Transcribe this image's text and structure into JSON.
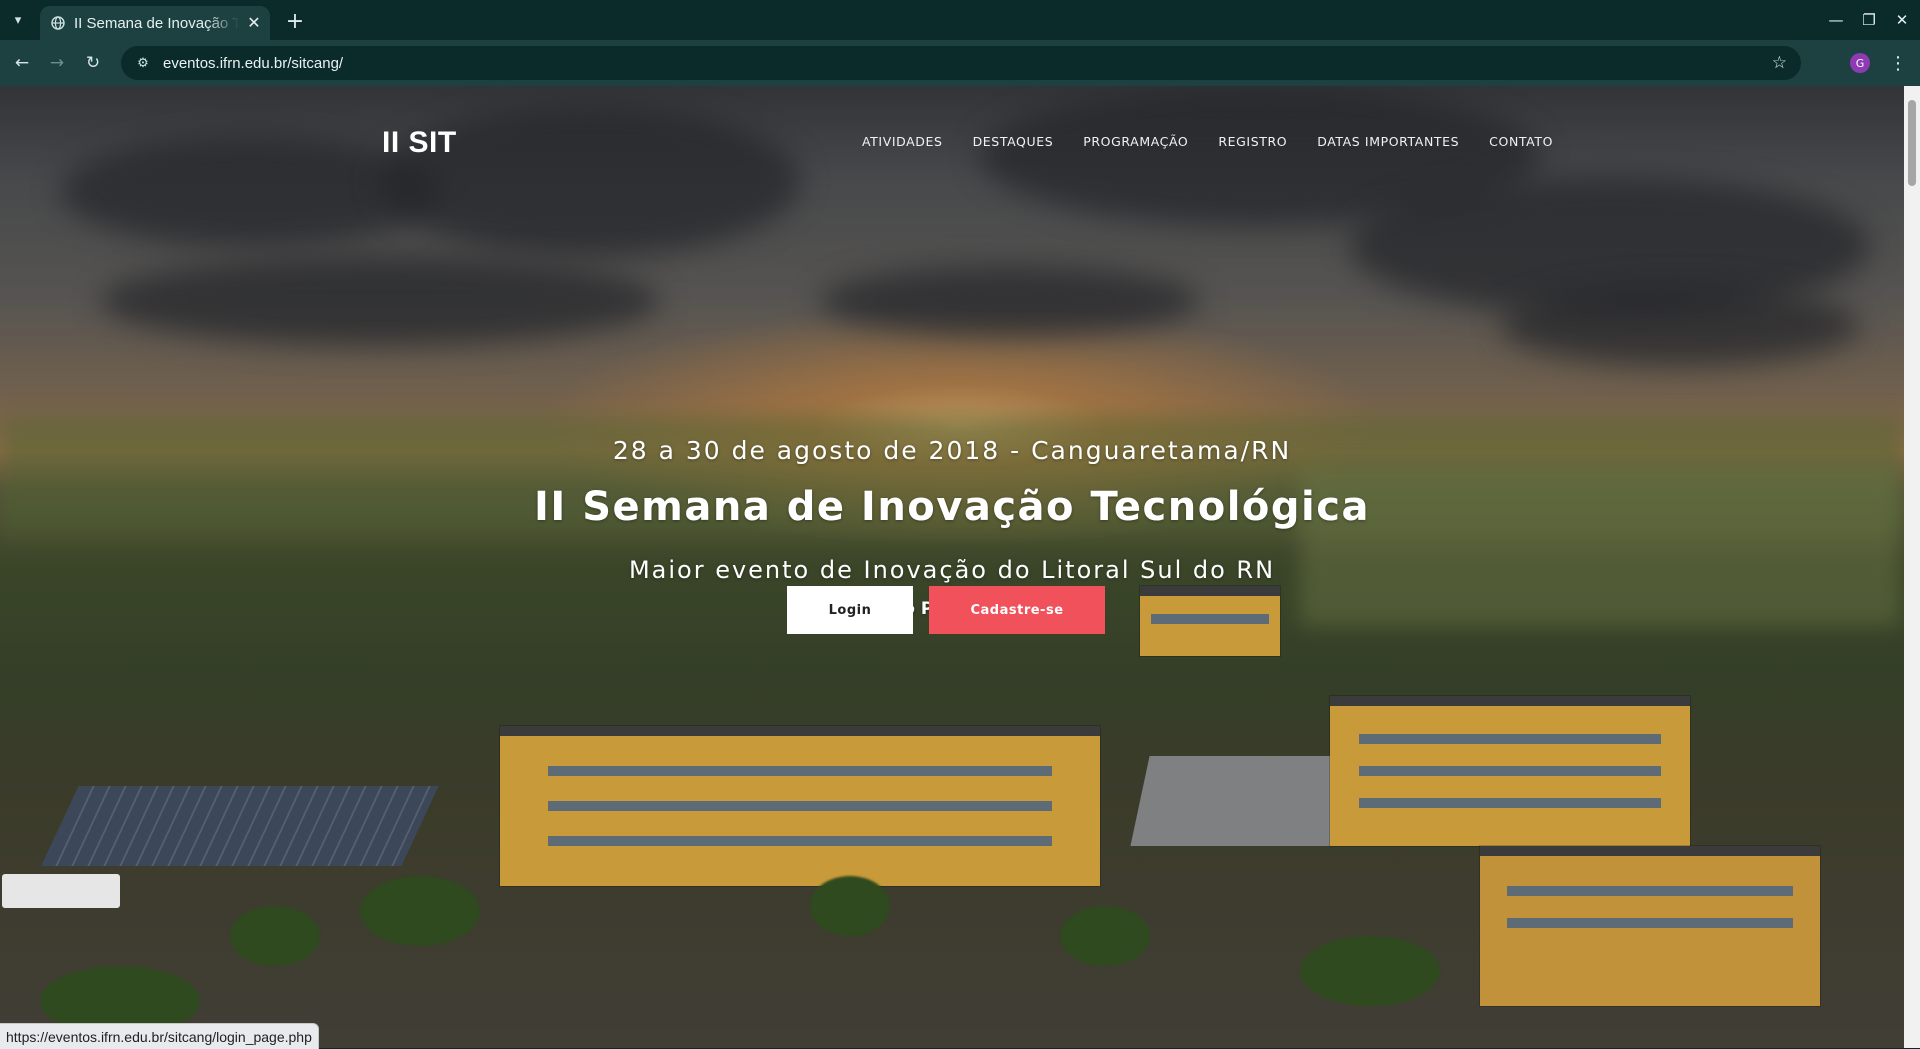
{
  "browser": {
    "tab_title": "II Semana de Inovação Tecnológica",
    "url": "eventos.ifrn.edu.br/sitcang/",
    "profile_initial": "G",
    "status_url": "https://eventos.ifrn.edu.br/sitcang/login_page.php",
    "icons": {
      "tab_search": "▾",
      "favicon": "globe-icon",
      "tab_close": "✕",
      "new_tab": "+",
      "minimize": "—",
      "restore": "❐",
      "close": "✕",
      "back": "←",
      "forward": "→",
      "reload": "↻",
      "site_info": "⚙",
      "bookmark": "☆",
      "menu": "⋮"
    }
  },
  "site": {
    "brand": "II SIT",
    "nav": [
      "ATIVIDADES",
      "DESTAQUES",
      "PROGRAMAÇÃO",
      "REGISTRO",
      "DATAS IMPORTANTES",
      "CONTATO"
    ],
    "hero": {
      "date": "28 a 30 de agosto de 2018 - Canguaretama/RN",
      "title": "II Semana de Inovação Tecnológica",
      "subtitle": "Maior evento de Inovação do Litoral Sul do RN",
      "audience": "Aberto ao Público em Geral"
    },
    "buttons": {
      "login": "Login",
      "signup": "Cadastre-se"
    },
    "colors": {
      "signup_button": "#f0515b",
      "browser_frame": "#0b2b2b"
    }
  }
}
